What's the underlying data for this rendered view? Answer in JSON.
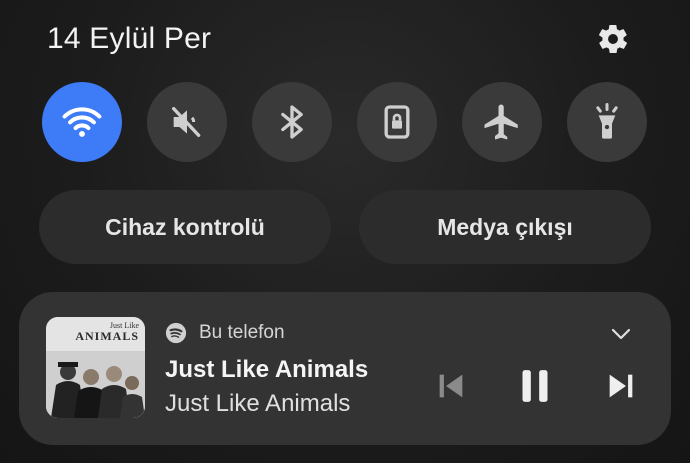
{
  "header": {
    "date": "14 Eylül Per",
    "settings_icon": "gear-icon"
  },
  "quick_toggles": [
    {
      "id": "wifi",
      "icon": "wifi-icon",
      "active": true,
      "color": "#3e7bf7"
    },
    {
      "id": "sound",
      "icon": "mute-icon",
      "active": false
    },
    {
      "id": "bluetooth",
      "icon": "bluetooth-icon",
      "active": false
    },
    {
      "id": "rotation-lock",
      "icon": "rotation-lock-icon",
      "active": false
    },
    {
      "id": "airplane",
      "icon": "airplane-icon",
      "active": false
    },
    {
      "id": "flashlight",
      "icon": "flashlight-icon",
      "active": false
    }
  ],
  "actions": {
    "device_control": "Cihaz kontrolü",
    "media_output": "Medya çıkışı"
  },
  "media_player": {
    "source_icon": "spotify-icon",
    "source_label": "Bu telefon",
    "title": "Just Like Animals",
    "artist": "Just Like Animals",
    "album_art_text_top": "Just Like",
    "album_art_text_main": "ANIMALS",
    "controls": [
      "previous-icon",
      "pause-icon",
      "next-icon"
    ],
    "expand_icon": "chevron-down-icon"
  },
  "colors": {
    "accent": "#3e7bf7",
    "toggle_inactive": "#3a3a3a",
    "card": "#333333"
  }
}
